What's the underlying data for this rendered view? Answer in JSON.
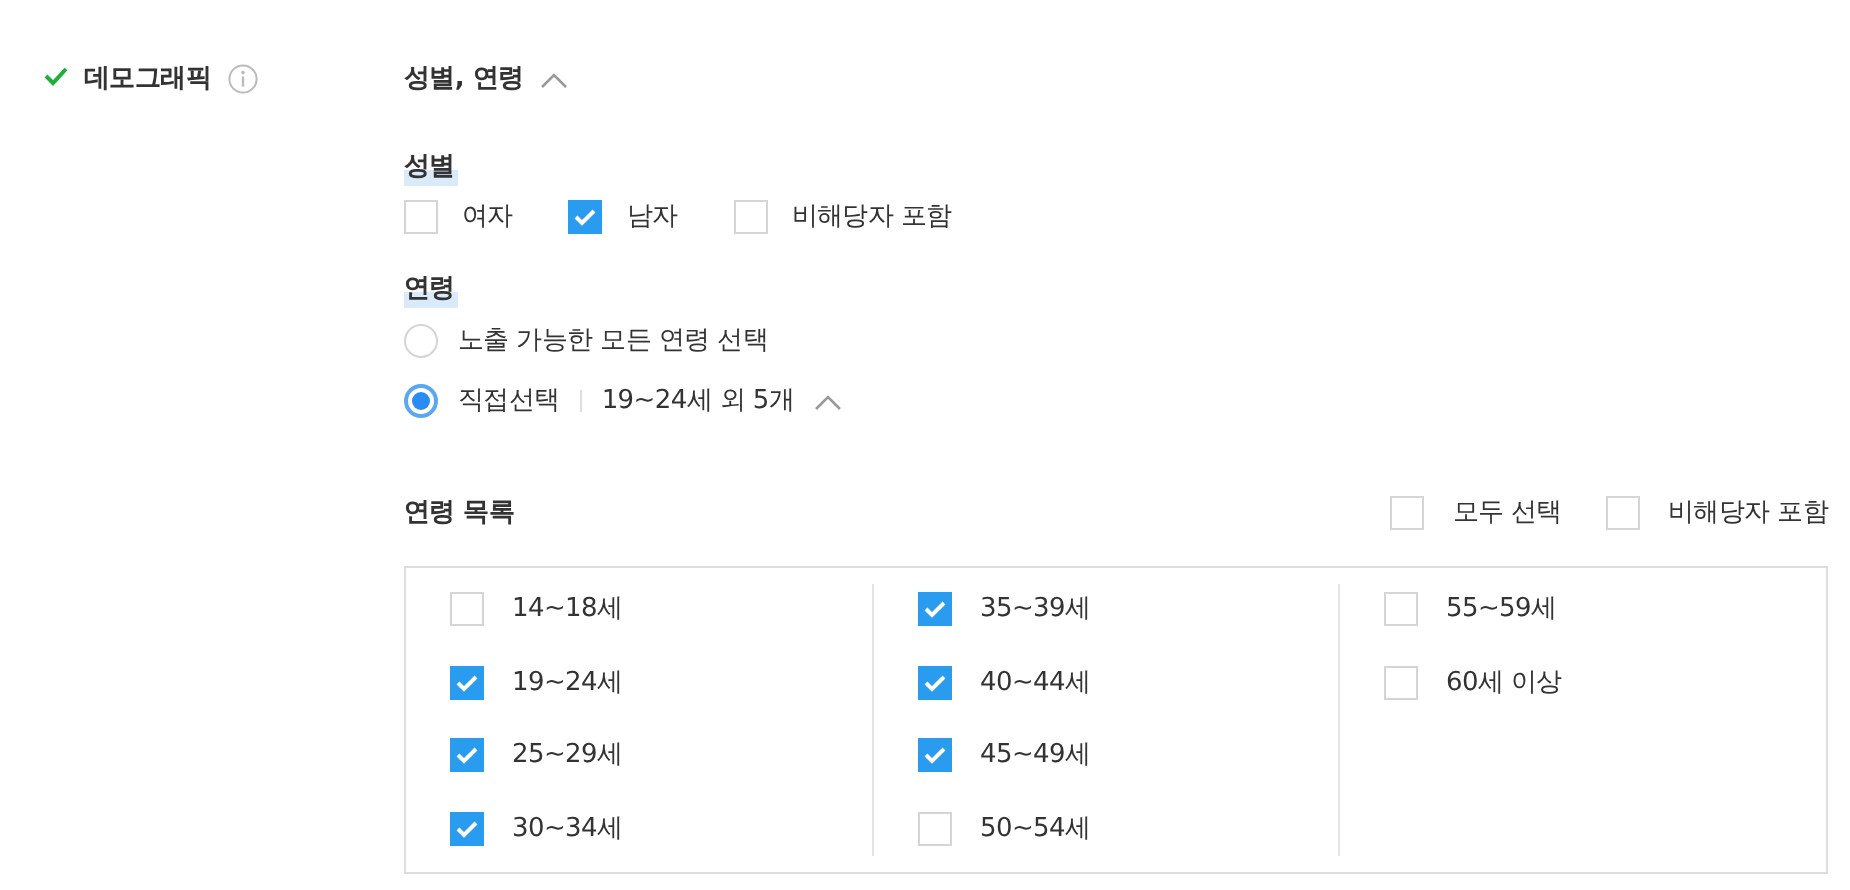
{
  "section": {
    "title": "데모그래픽",
    "completed": true
  },
  "summary": {
    "text": "성별, 연령",
    "expanded": true
  },
  "gender": {
    "label": "성별",
    "options": [
      {
        "label": "여자",
        "checked": false
      },
      {
        "label": "남자",
        "checked": true
      },
      {
        "label": "비해당자 포함",
        "checked": false
      }
    ]
  },
  "age": {
    "label": "연령",
    "options": [
      {
        "label": "노출 가능한 모든 연령 선택",
        "selected": false
      },
      {
        "label": "직접선택",
        "selected": true,
        "summary": "19~24세 외 5개",
        "expanded": true
      }
    ]
  },
  "age_list": {
    "title": "연령 목록",
    "controls": [
      {
        "label": "모두 선택",
        "checked": false
      },
      {
        "label": "비해당자 포함",
        "checked": false
      }
    ],
    "columns": [
      {
        "items": [
          {
            "label": "14~18세",
            "checked": false
          },
          {
            "label": "19~24세",
            "checked": true
          },
          {
            "label": "25~29세",
            "checked": true
          },
          {
            "label": "30~34세",
            "checked": true
          }
        ]
      },
      {
        "items": [
          {
            "label": "35~39세",
            "checked": true
          },
          {
            "label": "40~44세",
            "checked": true
          },
          {
            "label": "45~49세",
            "checked": true
          },
          {
            "label": "50~54세",
            "checked": false
          }
        ]
      },
      {
        "items": [
          {
            "label": "55~59세",
            "checked": false
          },
          {
            "label": "60세 이상",
            "checked": false
          }
        ]
      }
    ]
  }
}
